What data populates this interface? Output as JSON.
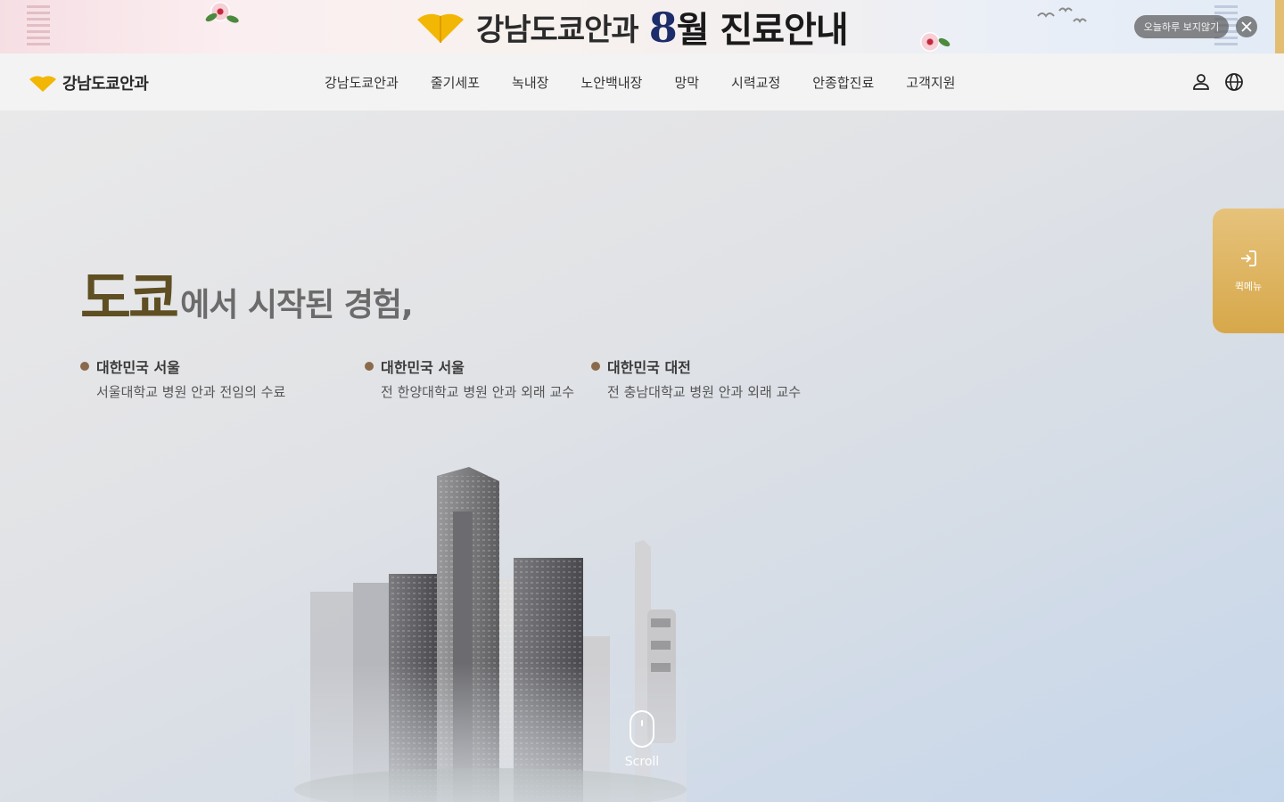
{
  "banner": {
    "brand": "강남도쿄안과",
    "headline_number": "8",
    "headline_text": "월 진료안내",
    "dismiss_label": "오늘하루 보지않기"
  },
  "nav": {
    "brand_name": "강남도쿄안과",
    "menu": [
      "강남도쿄안과",
      "줄기세포",
      "녹내장",
      "노안백내장",
      "망막",
      "시력교정",
      "안종합진료",
      "고객지원"
    ]
  },
  "hero": {
    "title_big": "도쿄",
    "title_rest": "에서 시작된 경험,",
    "careers": [
      {
        "place": "대한민국 서울",
        "desc": "서울대학교 병원 안과 전임의 수료"
      },
      {
        "place": "대한민국 서울",
        "desc": "전 한양대학교 병원 안과 외래 교수"
      },
      {
        "place": "대한민국 대전",
        "desc": "전 충남대학교 병원 안과 외래 교수"
      }
    ]
  },
  "quick_menu": {
    "label": "퀵메뉴"
  },
  "scroll": {
    "label": "Scroll"
  },
  "colors": {
    "accent_gold": "#d7a84a",
    "title_olive": "#5f4f22",
    "dot_brown": "#8b6a4c"
  }
}
